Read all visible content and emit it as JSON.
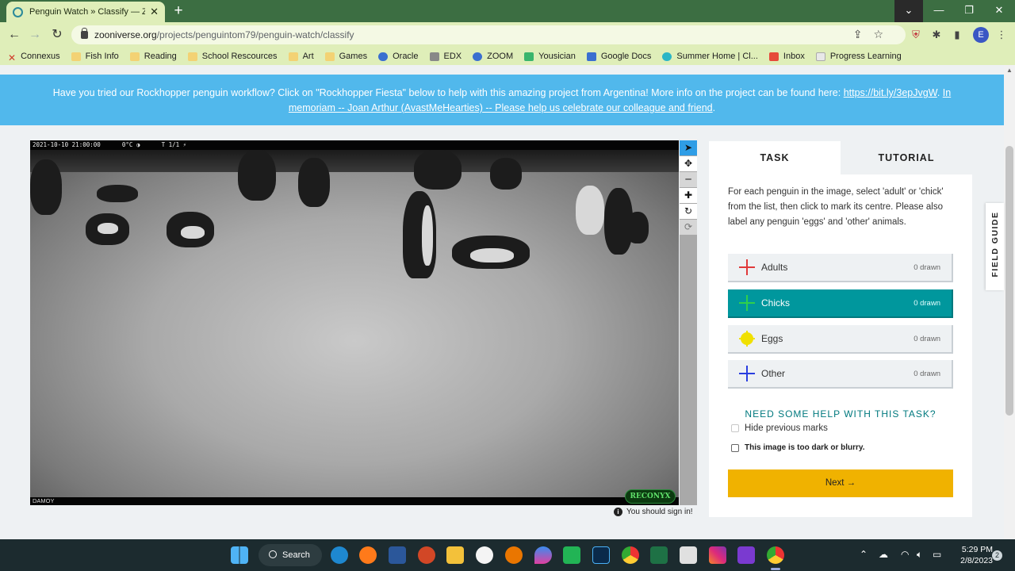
{
  "browser": {
    "tab_title": "Penguin Watch » Classify — Zoo",
    "url_domain": "zooniverse.org",
    "url_path": "/projects/penguintom79/penguin-watch/classify",
    "profile_initial": "E",
    "bookmarks": [
      "Connexus",
      "Fish Info",
      "Reading",
      "School Rescources",
      "Art",
      "Games",
      "Oracle",
      "EDX",
      "ZOOM",
      "Yousician",
      "Google Docs",
      "Summer Home | Cl...",
      "Inbox",
      "Progress Learning"
    ]
  },
  "banner": {
    "text": "Have you tried our Rockhopper penguin workflow? Click on \"Rockhopper Fiesta\" below to help with this amazing project from Argentina! More info on the project can be found here: ",
    "link1": "https://bit.ly/3epJvgW",
    "sep": ". ",
    "link2": "In memoriam -- Joan Arthur (AvastMeHearties) -- Please help us celebrate our colleague and friend",
    "end": "."
  },
  "subject": {
    "timestamp": "2021-10-10 21:00:00",
    "temperature": "0°C",
    "frame": "T 1/1",
    "location": "DAMOY",
    "camera_brand": "RECONYX"
  },
  "sign_in_notice": "You should sign in!",
  "panel": {
    "tab_task": "TASK",
    "tab_tutorial": "TUTORIAL",
    "instructions": "For each penguin in the image, select 'adult' or 'chick' from the list, then click to mark its centre. Please also label any penguin 'eggs' and 'other' animals.",
    "choices": [
      {
        "label": "Adults",
        "count": "0 drawn",
        "color": "#e0393a"
      },
      {
        "label": "Chicks",
        "count": "0 drawn",
        "color": "#2fd04b"
      },
      {
        "label": "Eggs",
        "count": "0 drawn",
        "color": "#f0e000"
      },
      {
        "label": "Other",
        "count": "0 drawn",
        "color": "#2a3ee0"
      }
    ],
    "selected_choice": "Chicks",
    "help_link": "NEED SOME HELP WITH THIS TASK?",
    "hide_marks": "Hide previous marks",
    "too_dark": "This image is too dark or blurry.",
    "next_button": "Next →"
  },
  "field_guide": "FIELD GUIDE",
  "taskbar": {
    "search": "Search",
    "time": "5:29 PM",
    "date": "2/8/2023",
    "notifications": "2"
  }
}
